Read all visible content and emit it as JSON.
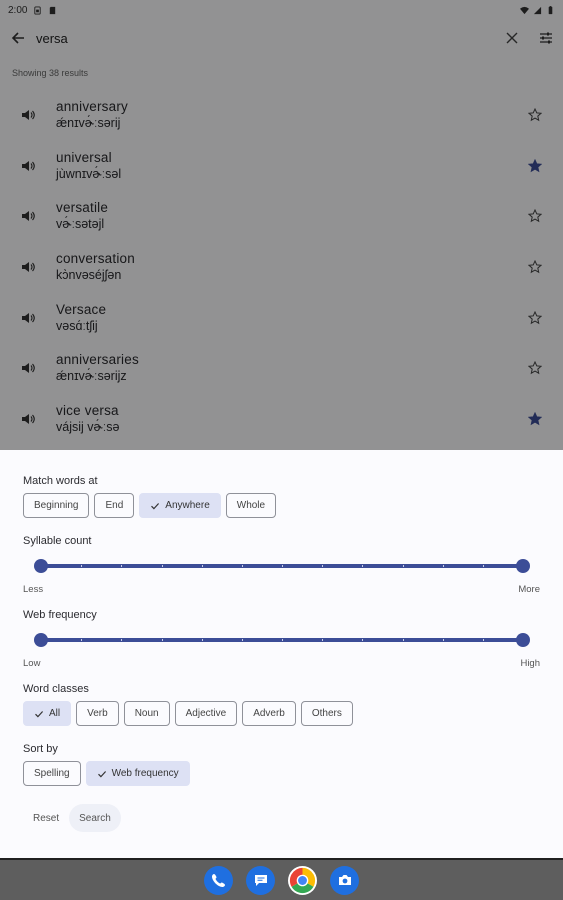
{
  "status_bar": {
    "time": "2:00"
  },
  "toolbar": {
    "query": "versa"
  },
  "results": {
    "count_label": "Showing 38 results",
    "items": [
      {
        "word": "anniversary",
        "ipa": "ǽnɪvɚ́ːsərij",
        "starred": false
      },
      {
        "word": "universal",
        "ipa": "jùwnɪvɚ́ːsəl",
        "starred": true
      },
      {
        "word": "versatile",
        "ipa": "vɚ́ːsətəjl",
        "starred": false
      },
      {
        "word": "conversation",
        "ipa": "kɔ̀nvəséjʃən",
        "starred": false
      },
      {
        "word": "Versace",
        "ipa": "vəsɑ́ːtʃij",
        "starred": false
      },
      {
        "word": "anniversaries",
        "ipa": "ǽnɪvɚ́ːsərijz",
        "starred": false
      },
      {
        "word": "vice versa",
        "ipa": "vájsij vɚ́ːsə",
        "starred": true
      }
    ]
  },
  "filters": {
    "match": {
      "label": "Match words at",
      "options": [
        {
          "label": "Beginning",
          "selected": false
        },
        {
          "label": "End",
          "selected": false
        },
        {
          "label": "Anywhere",
          "selected": true
        },
        {
          "label": "Whole",
          "selected": false
        }
      ]
    },
    "syllables": {
      "label": "Syllable count",
      "min_label": "Less",
      "max_label": "More",
      "range": [
        0,
        1
      ]
    },
    "frequency": {
      "label": "Web frequency",
      "min_label": "Low",
      "max_label": "High",
      "range": [
        0,
        1
      ]
    },
    "word_classes": {
      "label": "Word classes",
      "options": [
        {
          "label": "All",
          "selected": true
        },
        {
          "label": "Verb",
          "selected": false
        },
        {
          "label": "Noun",
          "selected": false
        },
        {
          "label": "Adjective",
          "selected": false
        },
        {
          "label": "Adverb",
          "selected": false
        },
        {
          "label": "Others",
          "selected": false
        }
      ]
    },
    "sort": {
      "label": "Sort by",
      "options": [
        {
          "label": "Spelling",
          "selected": false
        },
        {
          "label": "Web frequency",
          "selected": true
        }
      ]
    },
    "reset_label": "Reset",
    "search_label": "Search"
  },
  "dock": [
    "phone-icon",
    "messages-icon",
    "chrome-icon",
    "camera-icon"
  ],
  "colors": {
    "accent": "#3c4d97",
    "chip_selected": "#dde1f4",
    "star_filled": "#3c4d97"
  }
}
